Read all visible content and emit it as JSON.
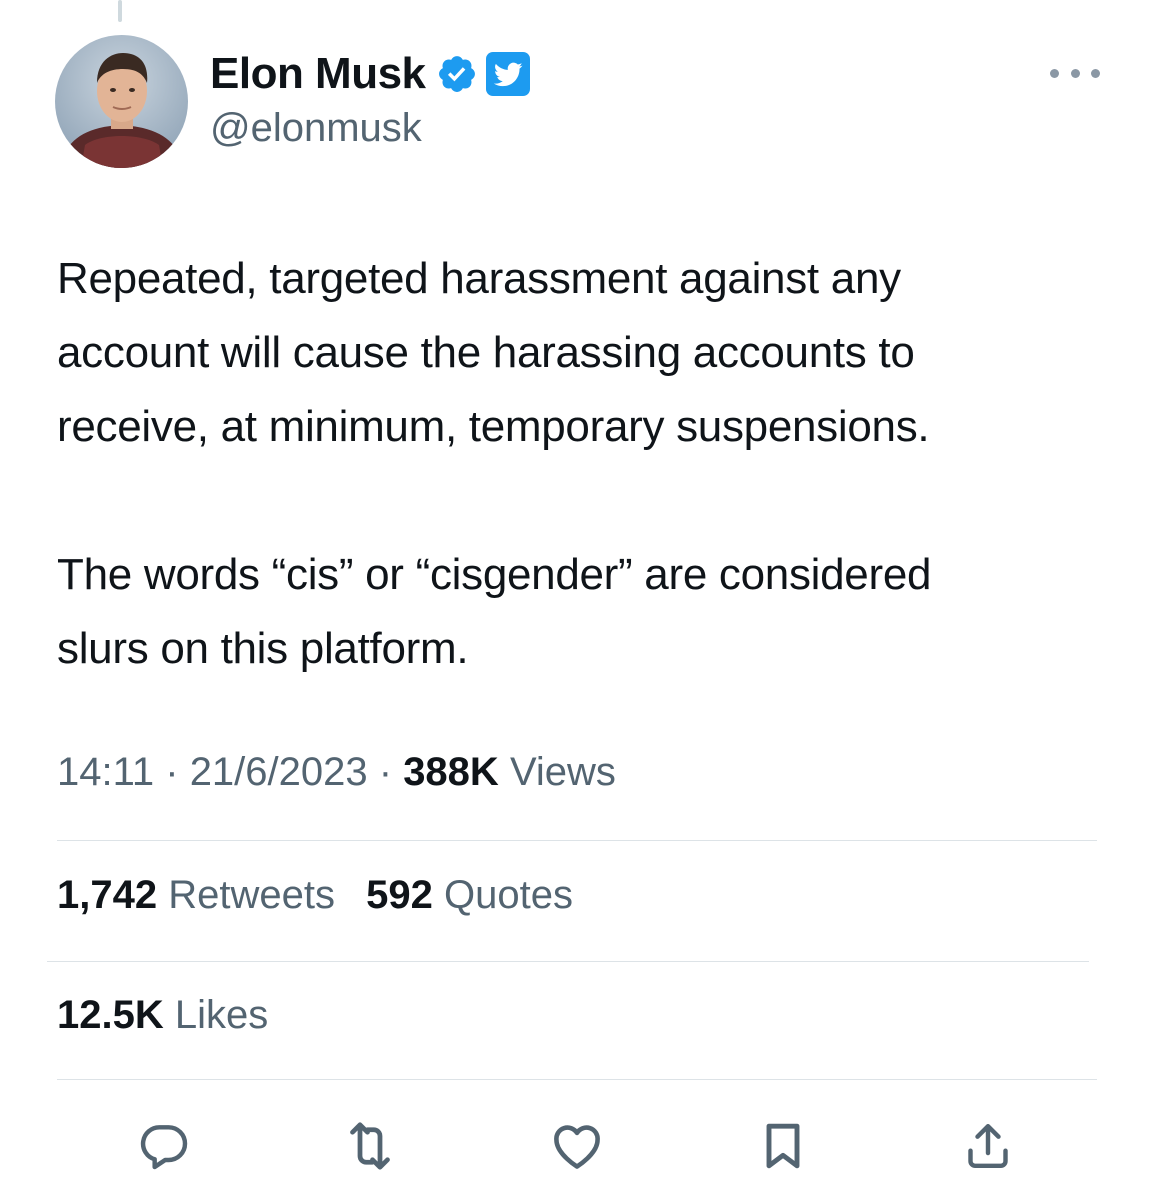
{
  "tweet": {
    "author": {
      "name": "Elon Musk",
      "handle": "@elonmusk"
    },
    "text_lines": [
      "Repeated, targeted harassment against any",
      "account will cause the harassing accounts to",
      "receive, at minimum, temporary suspensions.",
      "The words “cis” or “cisgender” are considered",
      "slurs on this platform."
    ],
    "time": "14:11",
    "date": "21/6/2023",
    "separator": " · ",
    "views_count": "388K",
    "views_label": "Views",
    "retweets_count": "1,742",
    "retweets_label": "Retweets",
    "quotes_count": "592",
    "quotes_label": "Quotes",
    "likes_count": "12.5K",
    "likes_label": "Likes"
  },
  "icons": {
    "verified": "verified-badge-icon",
    "affiliation": "twitter-bird-icon",
    "more": "more-icon",
    "reply": "reply-icon",
    "retweet": "retweet-icon",
    "like": "heart-icon",
    "bookmark": "bookmark-icon",
    "share": "share-icon"
  },
  "colors": {
    "accent": "#1d9bf0",
    "text": "#0f1419",
    "secondary": "#536471",
    "divider": "#dde3e7"
  }
}
